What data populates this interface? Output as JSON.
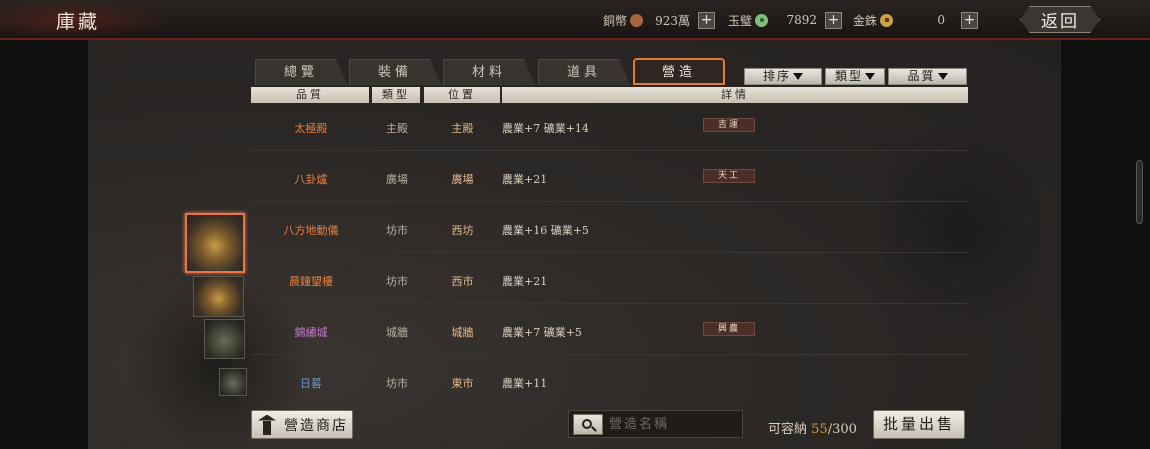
{
  "header": {
    "title": "庫藏",
    "back_label": "返回"
  },
  "currencies": [
    {
      "label": "銅幣",
      "icon": "copper-coin-icon",
      "value": "923萬"
    },
    {
      "label": "玉璧",
      "icon": "jade-disc-icon",
      "value": "7892"
    },
    {
      "label": "金銖",
      "icon": "gold-coin-icon",
      "value": "0"
    }
  ],
  "tabs": [
    {
      "label": "總覽",
      "active": false
    },
    {
      "label": "裝備",
      "active": false
    },
    {
      "label": "材料",
      "active": false
    },
    {
      "label": "道具",
      "active": false
    },
    {
      "label": "營造",
      "active": true
    }
  ],
  "filters": {
    "sort": "排序",
    "type": "類型",
    "quality": "品質"
  },
  "columns": {
    "quality": "品質",
    "type": "類型",
    "position": "位置",
    "detail": "詳情"
  },
  "rows": [
    {
      "name": "太極殿",
      "type": "主殿",
      "position": "主殿",
      "detail": "農業+7  礦業+14",
      "badge": "吉運",
      "color": "#e6803d"
    },
    {
      "name": "八卦爐",
      "type": "廣場",
      "position": "廣場",
      "detail": "農業+21",
      "badge": "天工",
      "color": "#e6803d"
    },
    {
      "name": "八方地動儀",
      "type": "坊市",
      "position": "西坊",
      "detail": "農業+16  礦業+5",
      "badge": "",
      "color": "#e6803d"
    },
    {
      "name": "晨鐘望樓",
      "type": "坊市",
      "position": "西市",
      "detail": "農業+21",
      "badge": "",
      "color": "#e6803d"
    },
    {
      "name": "錦繡城",
      "type": "城牆",
      "position": "城牆",
      "detail": "農業+7  礦業+5",
      "badge": "興農",
      "color": "#c676d0"
    },
    {
      "name": "日晷",
      "type": "坊市",
      "position": "東市",
      "detail": "農業+11",
      "badge": "",
      "color": "#6f95d2"
    }
  ],
  "bottom": {
    "shop_label": "營造商店",
    "search_placeholder": "營造名稱",
    "capacity_label": "可容納",
    "capacity_used": "55",
    "capacity_total": "/300",
    "sell_label": "批量出售"
  },
  "colors": {
    "accent": "#e47a33",
    "header_border": "#6b2318",
    "selected_thumb": "#e9754a"
  }
}
